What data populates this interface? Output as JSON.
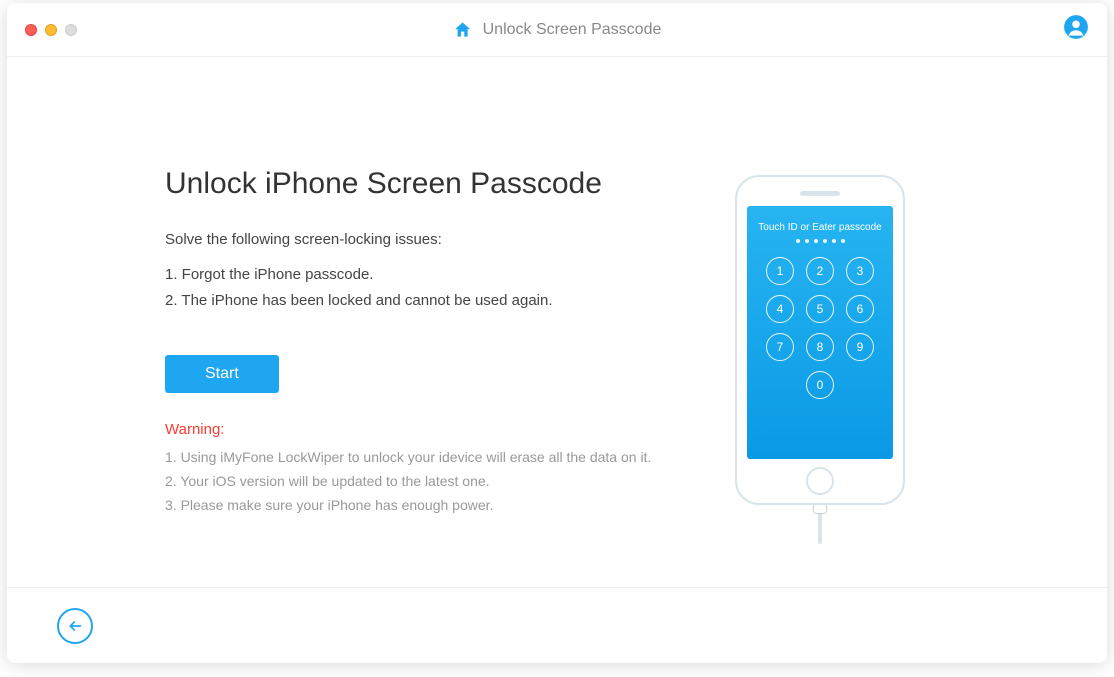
{
  "header": {
    "title": "Unlock Screen Passcode"
  },
  "main": {
    "heading": "Unlock iPhone Screen Passcode",
    "subtitle": "Solve the following screen-locking issues:",
    "issues": {
      "item1": "1. Forgot the iPhone passcode.",
      "item2": "2. The iPhone has been locked and cannot be used again."
    },
    "start_label": "Start",
    "warning_title": "Warning:",
    "warnings": {
      "item1": "1. Using iMyFone LockWiper to unlock your idevice will erase all the data on it.",
      "item2": "2. Your iOS version will be updated to the latest one.",
      "item3": "3. Please make sure your iPhone has enough power."
    }
  },
  "phone": {
    "screen_title": "Touch ID or Eater passcode",
    "keys": [
      "1",
      "2",
      "3",
      "4",
      "5",
      "6",
      "7",
      "8",
      "9",
      "0"
    ]
  },
  "colors": {
    "accent": "#1fa6f0",
    "warning": "#ff3b30"
  }
}
